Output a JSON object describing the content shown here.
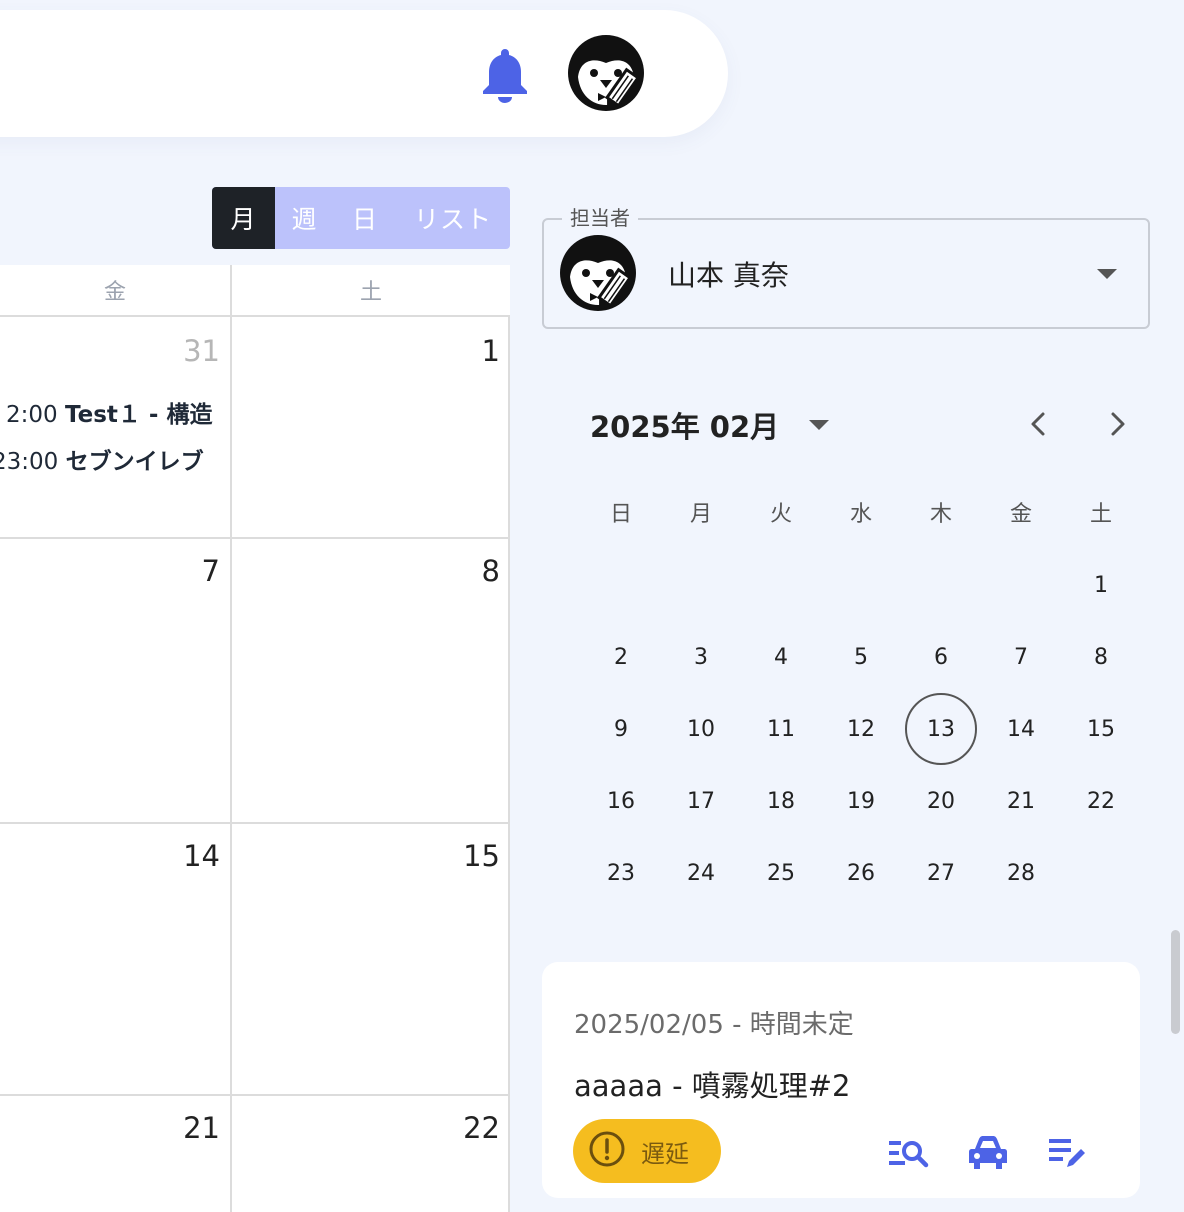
{
  "header": {
    "notifications_icon": "bell-icon",
    "user_avatar": "penguin-avatar"
  },
  "calendar": {
    "views": [
      "月",
      "週",
      "日",
      "リスト"
    ],
    "active_view": "月",
    "dow_headers": [
      "金",
      "土"
    ],
    "weeks": [
      {
        "fri": "31",
        "sat": "1",
        "fri_muted": true,
        "events": [
          {
            "time": "2:00",
            "title": "Test１ - 構造"
          },
          {
            "time": "23:00",
            "title": "セブンイレブ"
          }
        ]
      },
      {
        "fri": "7",
        "sat": "8"
      },
      {
        "fri": "14",
        "sat": "15"
      },
      {
        "fri": "21",
        "sat": "22"
      }
    ]
  },
  "assignee": {
    "label": "担当者",
    "name": "山本 真奈"
  },
  "mini_calendar": {
    "title": "2025年 02月",
    "dow": [
      "日",
      "月",
      "火",
      "水",
      "木",
      "金",
      "土"
    ],
    "days": [
      "1",
      "2",
      "3",
      "4",
      "5",
      "6",
      "7",
      "8",
      "9",
      "10",
      "11",
      "12",
      "13",
      "14",
      "15",
      "16",
      "17",
      "18",
      "19",
      "20",
      "21",
      "22",
      "23",
      "24",
      "25",
      "26",
      "27",
      "28"
    ],
    "first_weekday": 6,
    "today": "13"
  },
  "task_card": {
    "date": "2025/02/05",
    "time": "時間未定",
    "date_line": "2025/02/05 - 時間未定",
    "title": "aaaaa - 噴霧処理#2",
    "status": "遅延",
    "status_color": "#f5bd1f",
    "actions": [
      "list-search-icon",
      "car-icon",
      "edit-list-icon"
    ]
  },
  "colors": {
    "accent": "#4d63e6",
    "view_switch_bg": "#bcc2fb",
    "view_switch_active": "#1e2227"
  }
}
